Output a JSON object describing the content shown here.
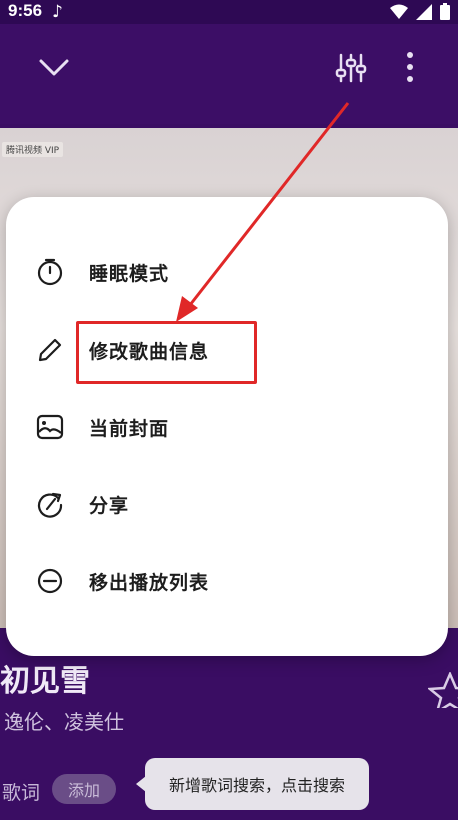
{
  "status_bar": {
    "time": "9:56",
    "note_icon": "music-note-icon",
    "icons": [
      "wifi-icon",
      "signal-icon",
      "battery-icon"
    ]
  },
  "toolbar": {
    "collapse_icon": "chevron-down-icon",
    "equalizer_icon": "equalizer-icon",
    "more_icon": "more-vertical-icon"
  },
  "cover": {
    "badge": "腾讯视频 VIP"
  },
  "menu": {
    "items": [
      {
        "label": "睡眠模式",
        "icon": "timer-icon"
      },
      {
        "label": "修改歌曲信息",
        "icon": "pencil-icon"
      },
      {
        "label": "当前封面",
        "icon": "image-icon"
      },
      {
        "label": "分享",
        "icon": "share-icon"
      },
      {
        "label": "移出播放列表",
        "icon": "remove-circle-icon"
      }
    ]
  },
  "song": {
    "title": "初见雪",
    "artist": "逸伦、凌美仕"
  },
  "lyrics": {
    "label": "歌词",
    "add_button": "添加"
  },
  "tooltip": {
    "text": "新增歌词搜索，点击搜索"
  },
  "colors": {
    "player_bg": "#3a0d63",
    "menu_bg": "#ffffff",
    "annotation": "#e02828"
  }
}
